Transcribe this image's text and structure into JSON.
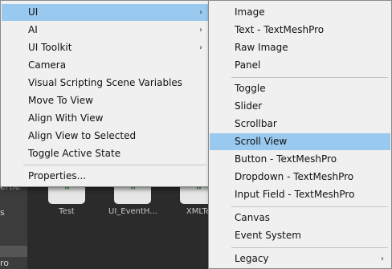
{
  "background": {
    "left_labels": [
      "ertie",
      "s",
      "ro"
    ],
    "assets": [
      "Test",
      "UI_EventH...",
      "XMLTe"
    ],
    "asset_glyph": "\""
  },
  "menu1": {
    "items": [
      {
        "label": "UI",
        "arrow": "›"
      },
      {
        "label": "AI",
        "arrow": "›"
      },
      {
        "label": "UI Toolkit",
        "arrow": "›"
      },
      {
        "label": "Camera"
      },
      {
        "label": "Visual Scripting Scene Variables"
      },
      {
        "label": "Move To View"
      },
      {
        "label": "Align With View"
      },
      {
        "label": "Align View to Selected"
      },
      {
        "label": "Toggle Active State"
      },
      {
        "label": "Properties..."
      }
    ],
    "highlighted": "UI"
  },
  "menu2": {
    "items": [
      {
        "label": "Image"
      },
      {
        "label": "Text - TextMeshPro"
      },
      {
        "label": "Raw Image"
      },
      {
        "label": "Panel"
      },
      {
        "label": "Toggle"
      },
      {
        "label": "Slider"
      },
      {
        "label": "Scrollbar"
      },
      {
        "label": "Scroll View"
      },
      {
        "label": "Button - TextMeshPro"
      },
      {
        "label": "Dropdown - TextMeshPro"
      },
      {
        "label": "Input Field - TextMeshPro"
      },
      {
        "label": "Canvas"
      },
      {
        "label": "Event System"
      },
      {
        "label": "Legacy",
        "arrow": "›"
      }
    ],
    "highlighted": "Scroll View"
  },
  "colors": {
    "menu_bg": "#f0f0f0",
    "highlight": "#99c9ef",
    "editor_bg": "#2b2b2b"
  }
}
